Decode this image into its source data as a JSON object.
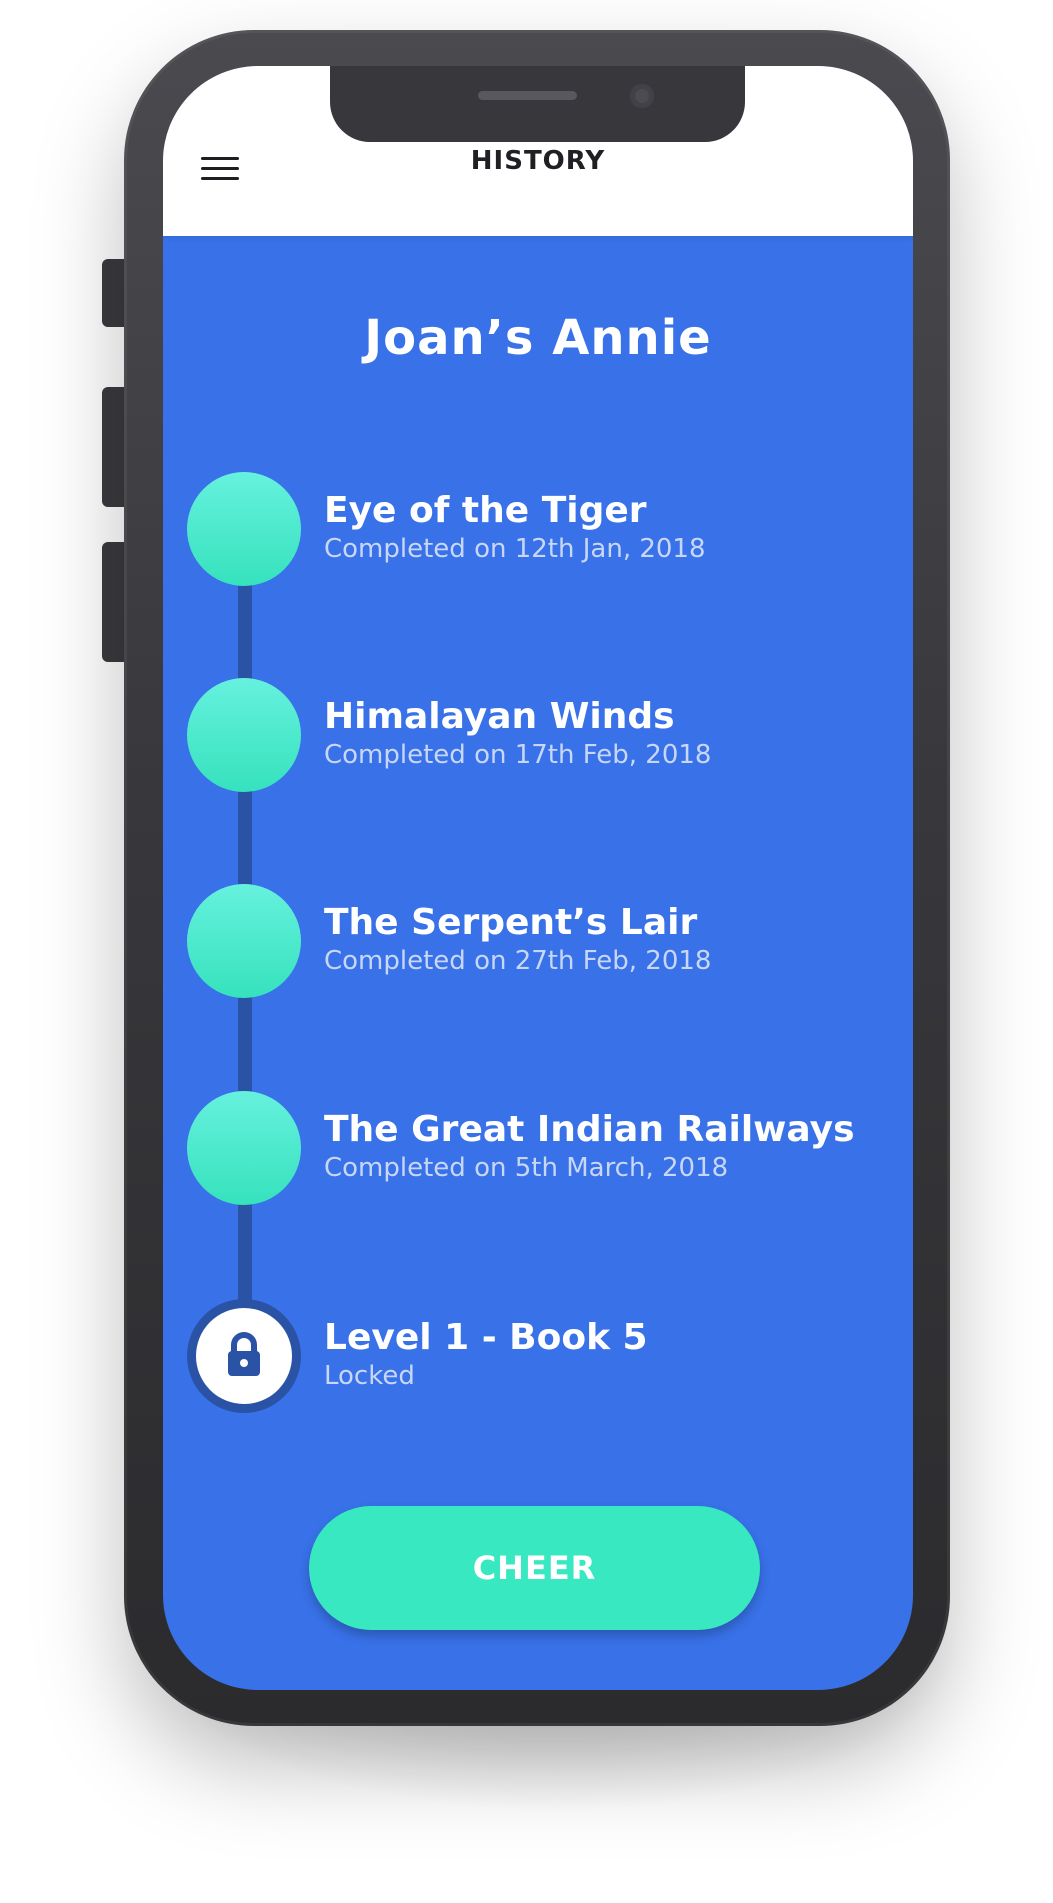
{
  "header": {
    "title": "HISTORY",
    "menu_icon": "hamburger-menu-icon"
  },
  "main": {
    "title": "Joan’s Annie",
    "items": [
      {
        "title": "Eye of the Tiger",
        "subtitle": "Completed on 12th Jan, 2018",
        "state": "completed"
      },
      {
        "title": "Himalayan Winds",
        "subtitle": "Completed on 17th Feb, 2018",
        "state": "completed"
      },
      {
        "title": "The Serpent’s Lair",
        "subtitle": "Completed on 27th Feb, 2018",
        "state": "completed"
      },
      {
        "title": "The Great Indian Railways",
        "subtitle": "Completed on 5th March, 2018",
        "state": "completed"
      },
      {
        "title": "Level 1 - Book 5",
        "subtitle": "Locked",
        "state": "locked",
        "icon": "lock-icon"
      }
    ]
  },
  "cheer_button": {
    "label": "CHEER"
  },
  "colors": {
    "background": "#3871e8",
    "accent": "#37e8c0",
    "timeline": "#2a52a5",
    "header": "#ffffff"
  }
}
